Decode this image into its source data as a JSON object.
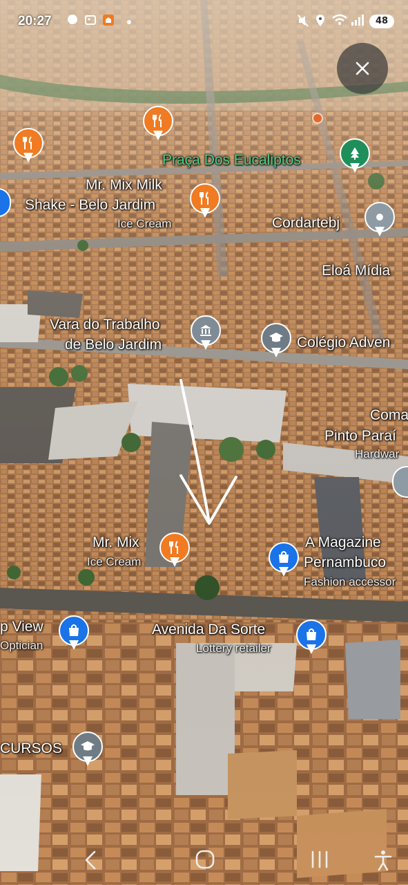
{
  "status_bar": {
    "time": "20:27",
    "battery": "48",
    "left_icons": [
      "messenger-icon",
      "gallery-icon",
      "home-app-icon",
      "dot-icon"
    ],
    "right_icons": [
      "mute-icon",
      "location-icon",
      "wifi-icon",
      "signal-icon"
    ]
  },
  "map": {
    "view": "3D aerial satellite view",
    "labels": {
      "praca": "Praça Dos Eucaliptos",
      "mrmix_milk_1": "Mr. Mix Milk",
      "mrmix_milk_2": "Shake - Belo Jardim",
      "mrmix_milk_cat": "Ice Cream",
      "cordartebj": "Cordartebj",
      "eloa": "Eloá Mídia",
      "vara_1": "Vara do Trabalho",
      "vara_2": "de Belo Jardim",
      "colegio": "Colégio Adven",
      "coma": "Coma",
      "pinto_para": "Pinto Paraí",
      "hardware": "Hardwar",
      "mrmix_1": "Mr. Mix",
      "mrmix_cat": "Ice Cream",
      "magazine_1": "A Magazine",
      "magazine_2": "Pernambuco",
      "magazine_cat": "Fashion accessor",
      "pview_1": "p View",
      "pview_cat": "Optician",
      "avenida": "Avenida Da Sorte",
      "avenida_cat": "Lottery retailer",
      "cursos": "CURSOS"
    },
    "pin_colors": {
      "food": "#f07b22",
      "park": "#1e8f5a",
      "place": "#8e9aa4",
      "shop": "#1a73e8",
      "civic": "#7f8c96",
      "school": "#6f7c86"
    }
  },
  "controls": {
    "close_icon": "close-icon"
  },
  "nav_bar": {
    "icons": [
      "back-icon",
      "home-icon",
      "recents-icon",
      "accessibility-icon"
    ]
  }
}
